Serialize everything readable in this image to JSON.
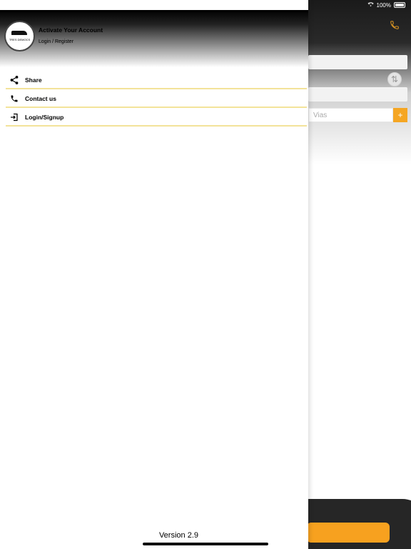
{
  "status_bar": {
    "battery": "100%"
  },
  "background": {
    "vias_placeholder": "Vias",
    "plus_label": "+"
  },
  "drawer": {
    "logo_text": "TRES DEMOCS",
    "header_title": "Activate Your Account",
    "header_subtitle": "Login / Register",
    "menu": [
      {
        "label": "Share",
        "icon": "share-icon"
      },
      {
        "label": "Contact us",
        "icon": "phone-icon"
      },
      {
        "label": "Login/Signup",
        "icon": "login-icon"
      }
    ],
    "version": "Version 2.9"
  },
  "colors": {
    "accent": "#f5a623",
    "divider": "#f3e39a"
  }
}
